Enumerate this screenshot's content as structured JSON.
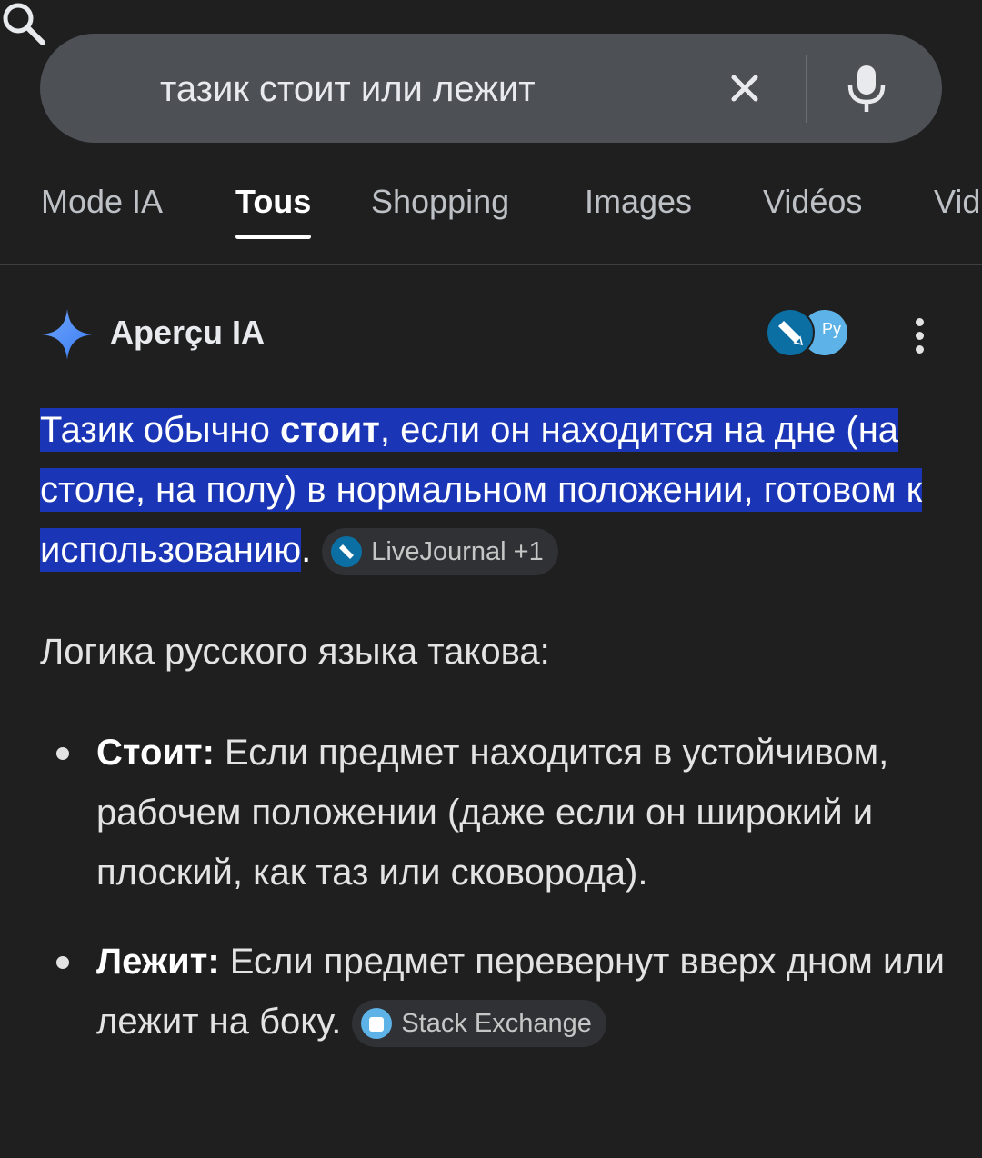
{
  "search": {
    "query": "тазик стоит или лежит"
  },
  "tabs": [
    {
      "label": "Mode IA",
      "active": false
    },
    {
      "label": "Tous",
      "active": true
    },
    {
      "label": "Shopping",
      "active": false
    },
    {
      "label": "Images",
      "active": false
    },
    {
      "label": "Vidéos",
      "active": false
    },
    {
      "label": "Vid",
      "active": false
    }
  ],
  "ai_overview": {
    "title": "Aperçu IA",
    "answer": {
      "part1": "Тазик обычно ",
      "bold": "стоит",
      "part2": ", если он находится на дне (на столе, на полу) в нормальном положении, готовом к использованию",
      "period": ".",
      "source_chip": "LiveJournal +1"
    },
    "intro": "Логика русского языка такова:",
    "bullets": [
      {
        "term": "Стоит:",
        "text": " Если предмет находится в устойчивом, рабочем положении (даже если он широкий и плоский, как таз или сковорода)."
      },
      {
        "term": "Лежит:",
        "text": " Если предмет перевернут вверх дном или лежит на боку.",
        "source_chip": "Stack Exchange"
      }
    ]
  },
  "colors": {
    "background": "#1f1f1f",
    "search_bar": "#4d5156",
    "highlight": "#1a35b5",
    "ai_sparkle": "#4c8df6"
  }
}
